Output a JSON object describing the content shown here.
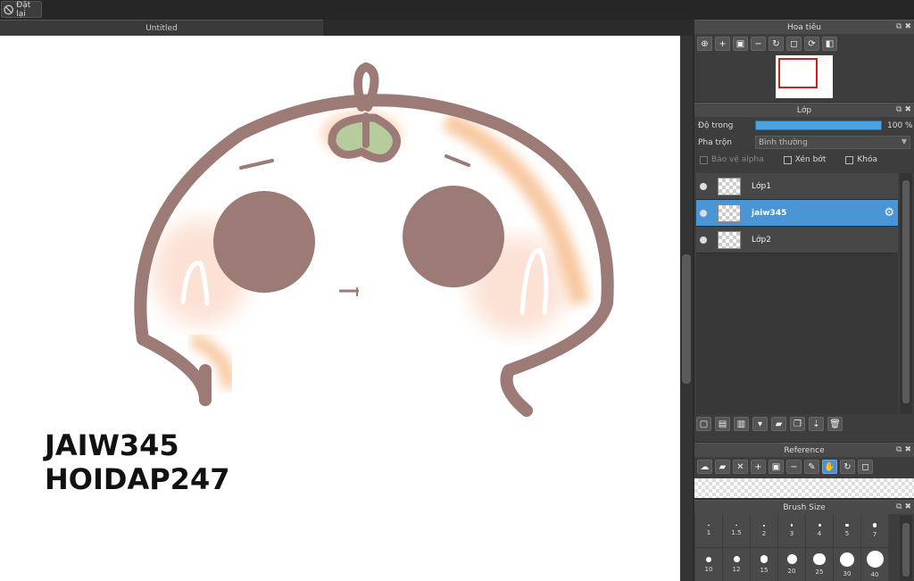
{
  "toolbar": {
    "reset_label": "Đặt lại"
  },
  "document": {
    "tab_title": "Untitled"
  },
  "canvas": {
    "watermark_line1": "JAIW345",
    "watermark_line2": "HOIDAP247"
  },
  "navigator": {
    "title": "Hoa tiêu",
    "tools": [
      "zoom-fit-icon",
      "zoom-in-icon",
      "fit-screen-icon",
      "zoom-out-icon",
      "rotate-icon",
      "actual-size-icon",
      "reset-rotation-icon",
      "flip-icon"
    ]
  },
  "layers": {
    "title": "Lớp",
    "opacity_label": "Độ trong",
    "opacity_value": "100 %",
    "opacity_fraction": 1.0,
    "blend_label": "Pha trộn",
    "blend_value": "Bình thường",
    "protect_alpha_label": "Bảo vệ alpha",
    "clipping_label": "Xén bớt",
    "lock_label": "Khóa",
    "items": [
      {
        "name": "Lớp1",
        "selected": false
      },
      {
        "name": "jaiw345",
        "selected": true
      },
      {
        "name": "Lớp2",
        "selected": false
      }
    ]
  },
  "reference": {
    "title": "Reference"
  },
  "brush_size": {
    "title": "Brush Size",
    "sizes": [
      "1",
      "1.5",
      "2",
      "3",
      "4",
      "5",
      "7",
      "10",
      "12",
      "15",
      "20",
      "25",
      "30",
      "40"
    ]
  },
  "colors": {
    "accent": "#4a95d6",
    "stroke": "#9c7a76"
  }
}
